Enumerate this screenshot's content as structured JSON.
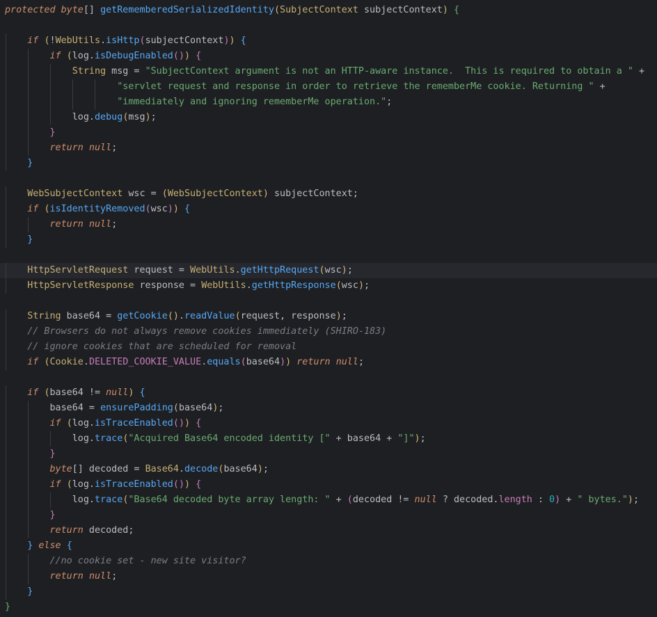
{
  "editor": {
    "language": "Java",
    "current_line_index": 17,
    "lines": [
      "protected byte[] getRememberedSerializedIdentity(SubjectContext subjectContext) {",
      "",
      "    if (!WebUtils.isHttp(subjectContext)) {",
      "        if (log.isDebugEnabled()) {",
      "            String msg = \"SubjectContext argument is not an HTTP-aware instance.  This is required to obtain a \" +",
      "                    \"servlet request and response in order to retrieve the rememberMe cookie. Returning \" +",
      "                    \"immediately and ignoring rememberMe operation.\";",
      "            log.debug(msg);",
      "        }",
      "        return null;",
      "    }",
      "",
      "    WebSubjectContext wsc = (WebSubjectContext) subjectContext;",
      "    if (isIdentityRemoved(wsc)) {",
      "        return null;",
      "    }",
      "",
      "    HttpServletRequest request = WebUtils.getHttpRequest(wsc);",
      "    HttpServletResponse response = WebUtils.getHttpResponse(wsc);",
      "",
      "    String base64 = getCookie().readValue(request, response);",
      "    // Browsers do not always remove cookies immediately (SHIRO-183)",
      "    // ignore cookies that are scheduled for removal",
      "    if (Cookie.DELETED_COOKIE_VALUE.equals(base64)) return null;",
      "",
      "    if (base64 != null) {",
      "        base64 = ensurePadding(base64);",
      "        if (log.isTraceEnabled()) {",
      "            log.trace(\"Acquired Base64 encoded identity [\" + base64 + \"]\");",
      "        }",
      "        byte[] decoded = Base64.decode(base64);",
      "        if (log.isTraceEnabled()) {",
      "            log.trace(\"Base64 decoded byte array length: \" + (decoded != null ? decoded.length : 0) + \" bytes.\");",
      "        }",
      "        return decoded;",
      "    } else {",
      "        //no cookie set - new site visitor?",
      "        return null;",
      "    }",
      "}"
    ]
  }
}
